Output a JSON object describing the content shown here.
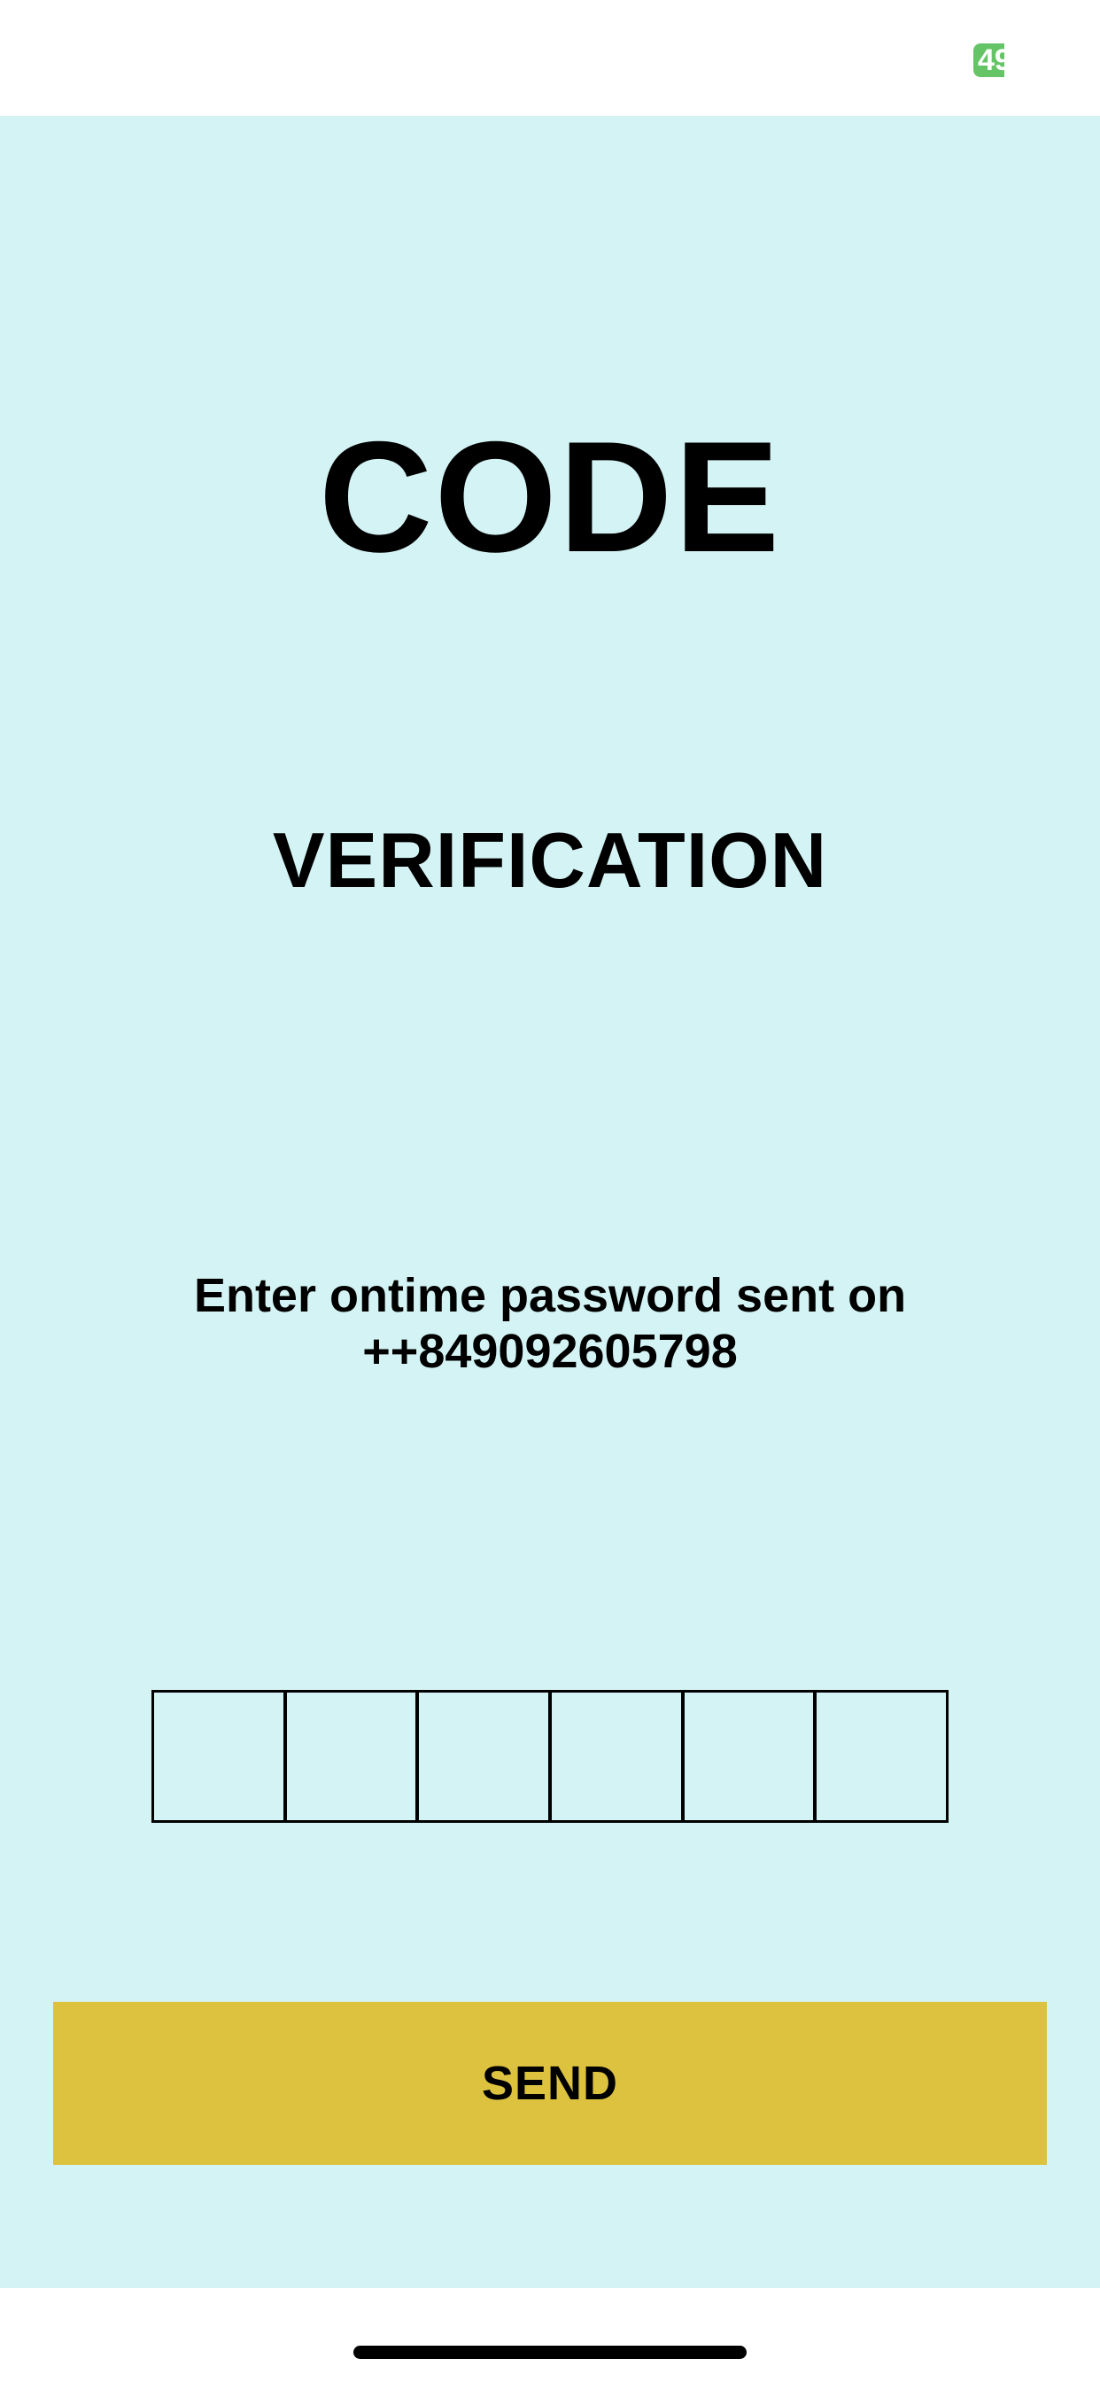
{
  "status_bar": {
    "battery_level": "49",
    "battery_color": "#65c466"
  },
  "screen": {
    "title": "CODE",
    "subtitle": "VERIFICATION",
    "instruction_line1": "Enter ontime password sent on",
    "instruction_line2": "++849092605798",
    "background_color": "#d4f3f4"
  },
  "otp": {
    "length": 6,
    "digits": [
      "",
      "",
      "",
      "",
      "",
      ""
    ]
  },
  "send_button": {
    "label": "SEND",
    "color": "#dcc23f"
  }
}
